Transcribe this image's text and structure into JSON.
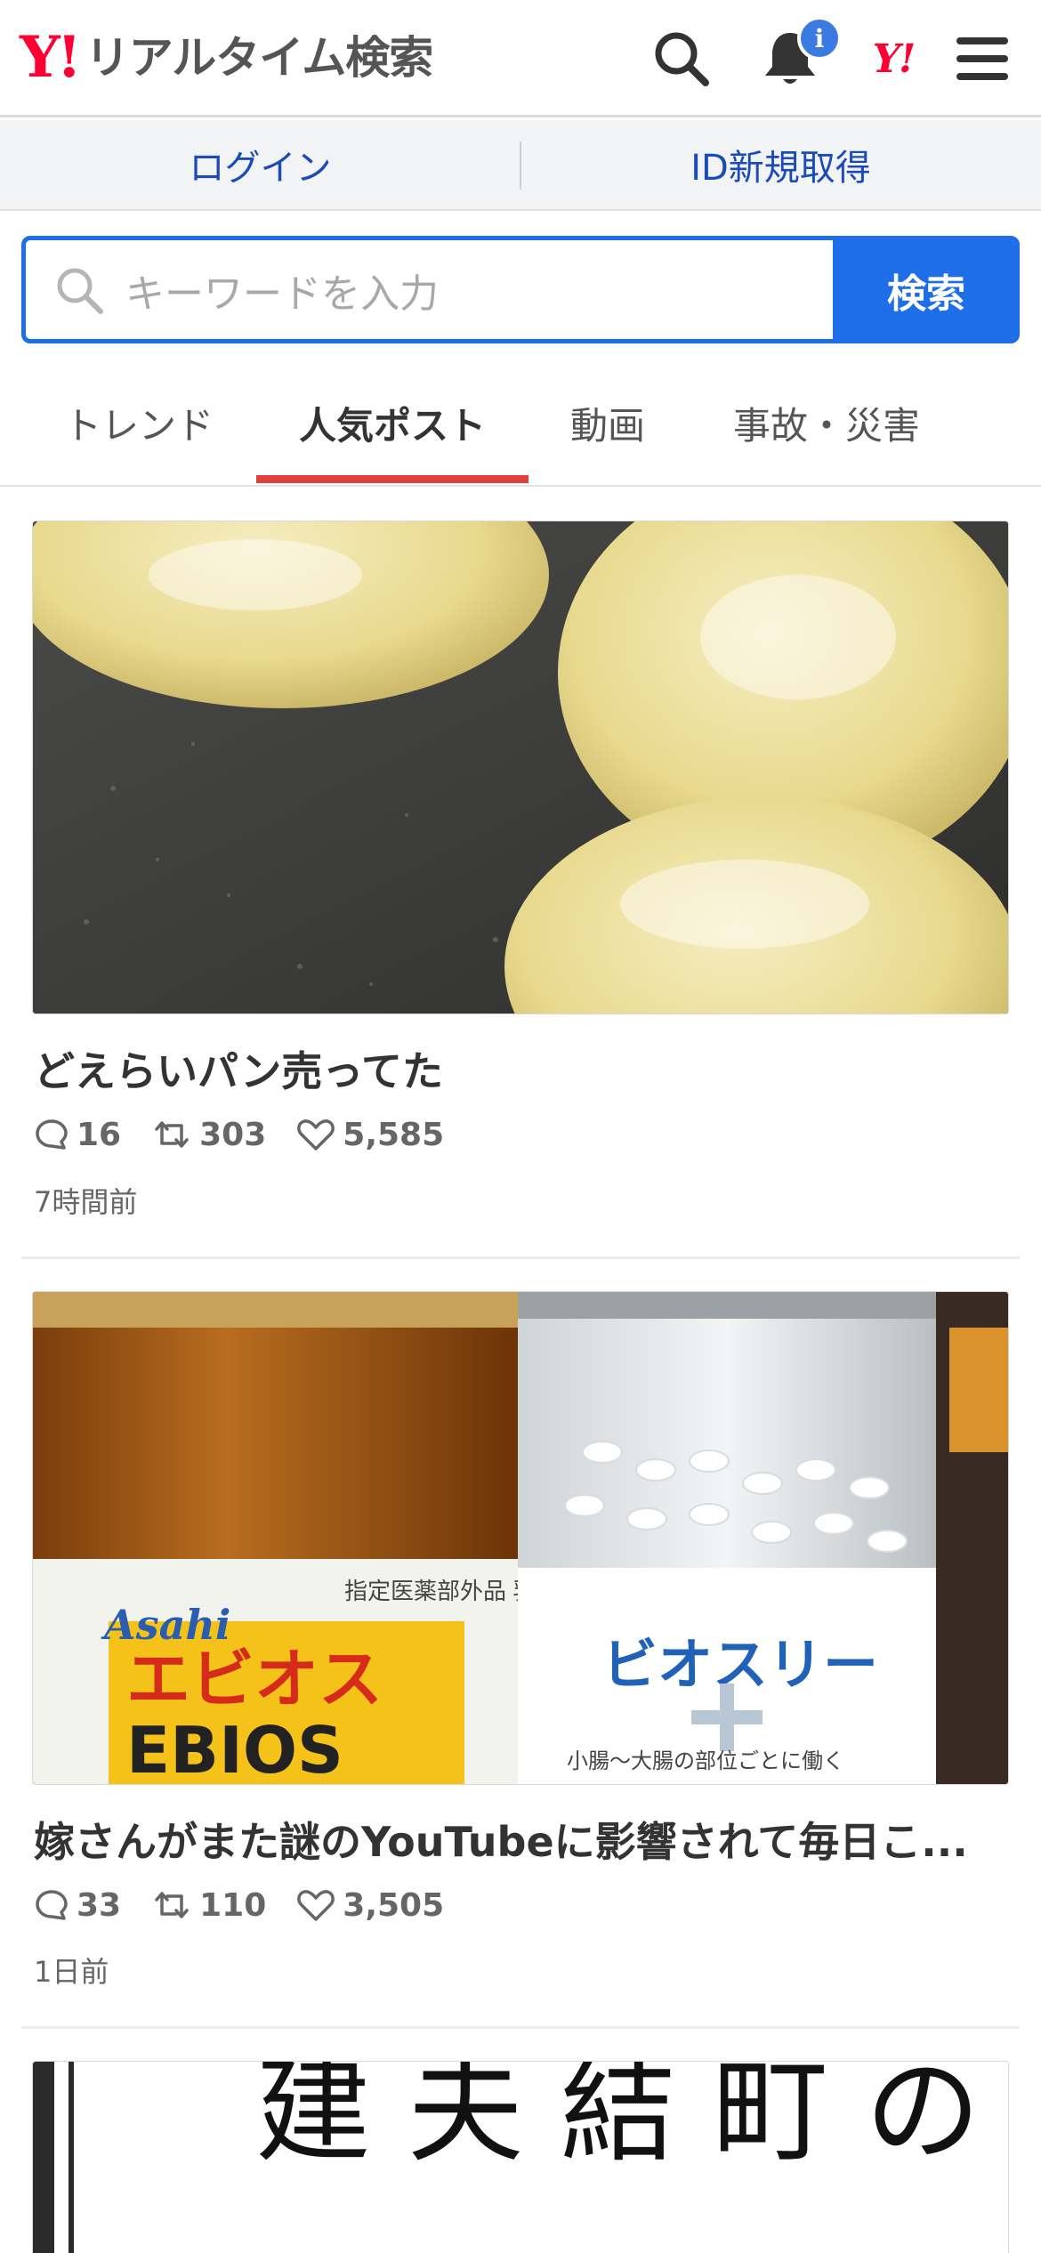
{
  "header": {
    "logo_mark": "Y!",
    "logo_text": "リアルタイム検索",
    "notification_badge": "i",
    "yahoo_mark": "Y!"
  },
  "account": {
    "login_label": "ログイン",
    "register_label": "ID新規取得"
  },
  "search": {
    "placeholder": "キーワードを入力",
    "button_label": "検索"
  },
  "tabs": [
    {
      "label": "トレンド",
      "active": false
    },
    {
      "label": "人気ポスト",
      "active": true
    },
    {
      "label": "動画",
      "active": false
    },
    {
      "label": "事故・災害",
      "active": false
    }
  ],
  "posts": [
    {
      "title": "どえらいパン売ってた",
      "replies": "16",
      "reposts": "303",
      "likes": "5,585",
      "time": "7時間前",
      "image": "bread-rolls-photo"
    },
    {
      "title": "嫁さんがまた謎のYouTubeに影響されて毎日こ...",
      "replies": "33",
      "reposts": "110",
      "likes": "3,505",
      "time": "1日前",
      "image": "supplement-bottles-photo",
      "image_labels": {
        "left_brand": "Asahi",
        "left_product_jp": "エビオス",
        "left_product_en": "EBIOS",
        "left_tag": "指定医薬部外品 乳酸菌整腸薬",
        "right_product_jp": "ビオスリー",
        "right_subtext": "小腸〜大腸の部位ごとに働く"
      }
    },
    {
      "image": "vertical-japanese-text-photo",
      "image_text": "建 夫 結 町 の 建 婦 婚"
    }
  ],
  "colors": {
    "brand_red": "#ff0033",
    "accent_blue": "#1e6ee8",
    "tab_underline": "#e0403c",
    "link_blue": "#1a4bb8"
  }
}
